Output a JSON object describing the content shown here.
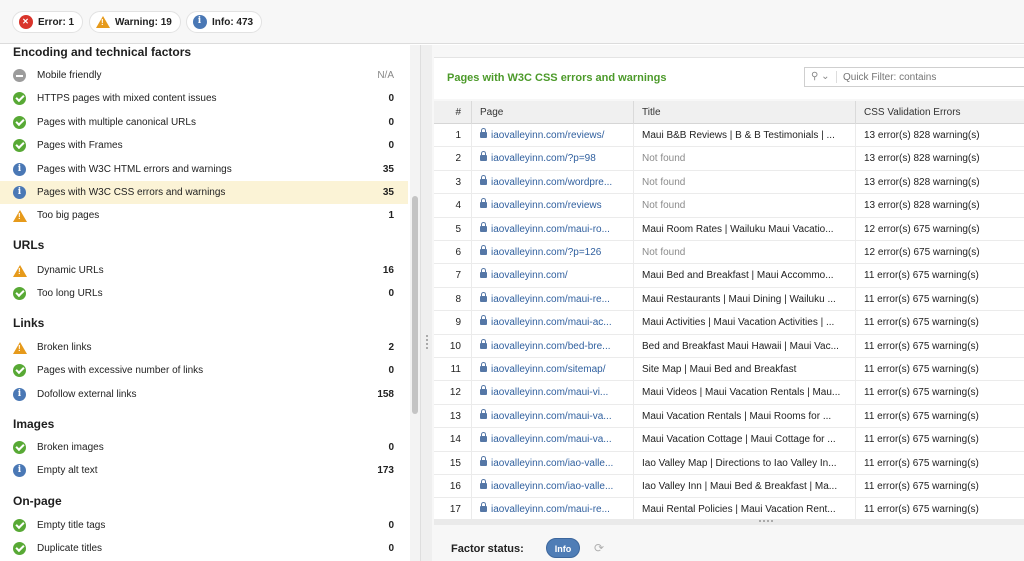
{
  "status": {
    "error_label": "Error: 1",
    "warning_label": "Warning: 19",
    "info_label": "Info: 473"
  },
  "left_panel": {
    "sections": [
      {
        "title": "Encoding and technical factors",
        "items": [
          {
            "label": "Mobile friendly",
            "count": "N/A",
            "icon": "na"
          },
          {
            "label": "HTTPS pages with mixed content issues",
            "count": "0",
            "icon": "ok"
          },
          {
            "label": "Pages with multiple canonical URLs",
            "count": "0",
            "icon": "ok"
          },
          {
            "label": "Pages with Frames",
            "count": "0",
            "icon": "ok"
          },
          {
            "label": "Pages with W3C HTML errors and warnings",
            "count": "35",
            "icon": "info"
          },
          {
            "label": "Pages with W3C CSS errors and warnings",
            "count": "35",
            "icon": "info",
            "selected": true
          },
          {
            "label": "Too big pages",
            "count": "1",
            "icon": "warning"
          }
        ]
      },
      {
        "title": "URLs",
        "items": [
          {
            "label": "Dynamic URLs",
            "count": "16",
            "icon": "warning"
          },
          {
            "label": "Too long URLs",
            "count": "0",
            "icon": "ok"
          }
        ]
      },
      {
        "title": "Links",
        "items": [
          {
            "label": "Broken links",
            "count": "2",
            "icon": "warning"
          },
          {
            "label": "Pages with excessive number of links",
            "count": "0",
            "icon": "ok"
          },
          {
            "label": "Dofollow external links",
            "count": "158",
            "icon": "info"
          }
        ]
      },
      {
        "title": "Images",
        "items": [
          {
            "label": "Broken images",
            "count": "0",
            "icon": "ok"
          },
          {
            "label": "Empty alt text",
            "count": "173",
            "icon": "info"
          }
        ]
      },
      {
        "title": "On-page",
        "items": [
          {
            "label": "Empty title tags",
            "count": "0",
            "icon": "ok"
          },
          {
            "label": "Duplicate titles",
            "count": "0",
            "icon": "ok"
          }
        ]
      }
    ]
  },
  "right_panel": {
    "title": "Pages with W3C CSS errors and warnings",
    "filter_placeholder": "Quick Filter: contains",
    "columns": [
      "#",
      "Page",
      "Title",
      "CSS Validation Errors"
    ],
    "rows": [
      [
        "1",
        "iaovalleyinn.com/reviews/",
        "Maui B&B Reviews | B & B Testimonials | ...",
        "13 error(s) 828 warning(s)"
      ],
      [
        "2",
        "iaovalleyinn.com/?p=98",
        "Not found",
        "13 error(s) 828 warning(s)"
      ],
      [
        "3",
        "iaovalleyinn.com/wordpre...",
        "Not found",
        "13 error(s) 828 warning(s)"
      ],
      [
        "4",
        "iaovalleyinn.com/reviews",
        "Not found",
        "13 error(s) 828 warning(s)"
      ],
      [
        "5",
        "iaovalleyinn.com/maui-ro...",
        "Maui Room Rates | Wailuku Maui Vacatio...",
        "12 error(s) 675 warning(s)"
      ],
      [
        "6",
        "iaovalleyinn.com/?p=126",
        "Not found",
        "12 error(s) 675 warning(s)"
      ],
      [
        "7",
        "iaovalleyinn.com/",
        "Maui Bed and Breakfast | Maui Accommo...",
        "11 error(s) 675 warning(s)"
      ],
      [
        "8",
        "iaovalleyinn.com/maui-re...",
        "Maui Restaurants | Maui Dining | Wailuku ...",
        "11 error(s) 675 warning(s)"
      ],
      [
        "9",
        "iaovalleyinn.com/maui-ac...",
        "Maui Activities | Maui Vacation Activities | ...",
        "11 error(s) 675 warning(s)"
      ],
      [
        "10",
        "iaovalleyinn.com/bed-bre...",
        "Bed and Breakfast Maui Hawaii | Maui Vac...",
        "11 error(s) 675 warning(s)"
      ],
      [
        "11",
        "iaovalleyinn.com/sitemap/",
        "Site Map | Maui Bed and Breakfast",
        "11 error(s) 675 warning(s)"
      ],
      [
        "12",
        "iaovalleyinn.com/maui-vi...",
        "Maui Videos | Maui Vacation Rentals | Mau...",
        "11 error(s) 675 warning(s)"
      ],
      [
        "13",
        "iaovalleyinn.com/maui-va...",
        "Maui Vacation Rentals | Maui Rooms for ...",
        "11 error(s) 675 warning(s)"
      ],
      [
        "14",
        "iaovalleyinn.com/maui-va...",
        "Maui Vacation Cottage | Maui Cottage for ...",
        "11 error(s) 675 warning(s)"
      ],
      [
        "15",
        "iaovalleyinn.com/iao-valle...",
        "Iao Valley Map | Directions to Iao Valley In...",
        "11 error(s) 675 warning(s)"
      ],
      [
        "16",
        "iaovalleyinn.com/iao-valle...",
        "Iao Valley Inn | Maui Bed & Breakfast | Ma...",
        "11 error(s) 675 warning(s)"
      ],
      [
        "17",
        "iaovalleyinn.com/maui-re...",
        "Maui Rental Policies | Maui Vacation Rent...",
        "11 error(s) 675 warning(s)"
      ]
    ],
    "factor_status_label": "Factor status:",
    "factor_status_value": "Info"
  }
}
